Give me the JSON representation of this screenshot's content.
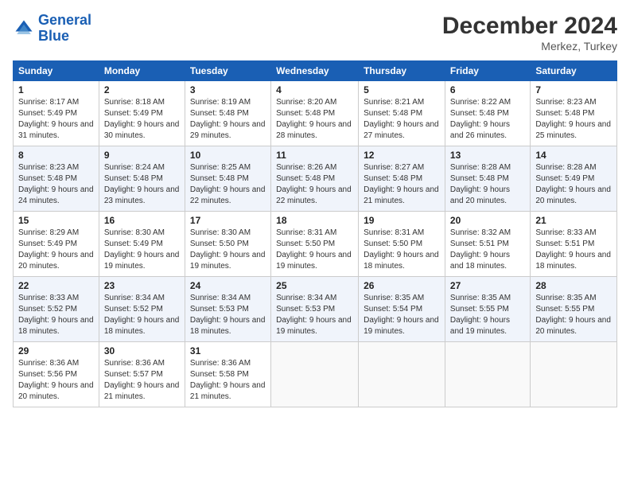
{
  "logo": {
    "line1": "General",
    "line2": "Blue"
  },
  "title": "December 2024",
  "location": "Merkez, Turkey",
  "weekdays": [
    "Sunday",
    "Monday",
    "Tuesday",
    "Wednesday",
    "Thursday",
    "Friday",
    "Saturday"
  ],
  "weeks": [
    [
      {
        "day": "1",
        "sunrise": "Sunrise: 8:17 AM",
        "sunset": "Sunset: 5:49 PM",
        "daylight": "Daylight: 9 hours and 31 minutes."
      },
      {
        "day": "2",
        "sunrise": "Sunrise: 8:18 AM",
        "sunset": "Sunset: 5:49 PM",
        "daylight": "Daylight: 9 hours and 30 minutes."
      },
      {
        "day": "3",
        "sunrise": "Sunrise: 8:19 AM",
        "sunset": "Sunset: 5:48 PM",
        "daylight": "Daylight: 9 hours and 29 minutes."
      },
      {
        "day": "4",
        "sunrise": "Sunrise: 8:20 AM",
        "sunset": "Sunset: 5:48 PM",
        "daylight": "Daylight: 9 hours and 28 minutes."
      },
      {
        "day": "5",
        "sunrise": "Sunrise: 8:21 AM",
        "sunset": "Sunset: 5:48 PM",
        "daylight": "Daylight: 9 hours and 27 minutes."
      },
      {
        "day": "6",
        "sunrise": "Sunrise: 8:22 AM",
        "sunset": "Sunset: 5:48 PM",
        "daylight": "Daylight: 9 hours and 26 minutes."
      },
      {
        "day": "7",
        "sunrise": "Sunrise: 8:23 AM",
        "sunset": "Sunset: 5:48 PM",
        "daylight": "Daylight: 9 hours and 25 minutes."
      }
    ],
    [
      {
        "day": "8",
        "sunrise": "Sunrise: 8:23 AM",
        "sunset": "Sunset: 5:48 PM",
        "daylight": "Daylight: 9 hours and 24 minutes."
      },
      {
        "day": "9",
        "sunrise": "Sunrise: 8:24 AM",
        "sunset": "Sunset: 5:48 PM",
        "daylight": "Daylight: 9 hours and 23 minutes."
      },
      {
        "day": "10",
        "sunrise": "Sunrise: 8:25 AM",
        "sunset": "Sunset: 5:48 PM",
        "daylight": "Daylight: 9 hours and 22 minutes."
      },
      {
        "day": "11",
        "sunrise": "Sunrise: 8:26 AM",
        "sunset": "Sunset: 5:48 PM",
        "daylight": "Daylight: 9 hours and 22 minutes."
      },
      {
        "day": "12",
        "sunrise": "Sunrise: 8:27 AM",
        "sunset": "Sunset: 5:48 PM",
        "daylight": "Daylight: 9 hours and 21 minutes."
      },
      {
        "day": "13",
        "sunrise": "Sunrise: 8:28 AM",
        "sunset": "Sunset: 5:48 PM",
        "daylight": "Daylight: 9 hours and 20 minutes."
      },
      {
        "day": "14",
        "sunrise": "Sunrise: 8:28 AM",
        "sunset": "Sunset: 5:49 PM",
        "daylight": "Daylight: 9 hours and 20 minutes."
      }
    ],
    [
      {
        "day": "15",
        "sunrise": "Sunrise: 8:29 AM",
        "sunset": "Sunset: 5:49 PM",
        "daylight": "Daylight: 9 hours and 20 minutes."
      },
      {
        "day": "16",
        "sunrise": "Sunrise: 8:30 AM",
        "sunset": "Sunset: 5:49 PM",
        "daylight": "Daylight: 9 hours and 19 minutes."
      },
      {
        "day": "17",
        "sunrise": "Sunrise: 8:30 AM",
        "sunset": "Sunset: 5:50 PM",
        "daylight": "Daylight: 9 hours and 19 minutes."
      },
      {
        "day": "18",
        "sunrise": "Sunrise: 8:31 AM",
        "sunset": "Sunset: 5:50 PM",
        "daylight": "Daylight: 9 hours and 19 minutes."
      },
      {
        "day": "19",
        "sunrise": "Sunrise: 8:31 AM",
        "sunset": "Sunset: 5:50 PM",
        "daylight": "Daylight: 9 hours and 18 minutes."
      },
      {
        "day": "20",
        "sunrise": "Sunrise: 8:32 AM",
        "sunset": "Sunset: 5:51 PM",
        "daylight": "Daylight: 9 hours and 18 minutes."
      },
      {
        "day": "21",
        "sunrise": "Sunrise: 8:33 AM",
        "sunset": "Sunset: 5:51 PM",
        "daylight": "Daylight: 9 hours and 18 minutes."
      }
    ],
    [
      {
        "day": "22",
        "sunrise": "Sunrise: 8:33 AM",
        "sunset": "Sunset: 5:52 PM",
        "daylight": "Daylight: 9 hours and 18 minutes."
      },
      {
        "day": "23",
        "sunrise": "Sunrise: 8:34 AM",
        "sunset": "Sunset: 5:52 PM",
        "daylight": "Daylight: 9 hours and 18 minutes."
      },
      {
        "day": "24",
        "sunrise": "Sunrise: 8:34 AM",
        "sunset": "Sunset: 5:53 PM",
        "daylight": "Daylight: 9 hours and 18 minutes."
      },
      {
        "day": "25",
        "sunrise": "Sunrise: 8:34 AM",
        "sunset": "Sunset: 5:53 PM",
        "daylight": "Daylight: 9 hours and 19 minutes."
      },
      {
        "day": "26",
        "sunrise": "Sunrise: 8:35 AM",
        "sunset": "Sunset: 5:54 PM",
        "daylight": "Daylight: 9 hours and 19 minutes."
      },
      {
        "day": "27",
        "sunrise": "Sunrise: 8:35 AM",
        "sunset": "Sunset: 5:55 PM",
        "daylight": "Daylight: 9 hours and 19 minutes."
      },
      {
        "day": "28",
        "sunrise": "Sunrise: 8:35 AM",
        "sunset": "Sunset: 5:55 PM",
        "daylight": "Daylight: 9 hours and 20 minutes."
      }
    ],
    [
      {
        "day": "29",
        "sunrise": "Sunrise: 8:36 AM",
        "sunset": "Sunset: 5:56 PM",
        "daylight": "Daylight: 9 hours and 20 minutes."
      },
      {
        "day": "30",
        "sunrise": "Sunrise: 8:36 AM",
        "sunset": "Sunset: 5:57 PM",
        "daylight": "Daylight: 9 hours and 21 minutes."
      },
      {
        "day": "31",
        "sunrise": "Sunrise: 8:36 AM",
        "sunset": "Sunset: 5:58 PM",
        "daylight": "Daylight: 9 hours and 21 minutes."
      },
      null,
      null,
      null,
      null
    ]
  ]
}
